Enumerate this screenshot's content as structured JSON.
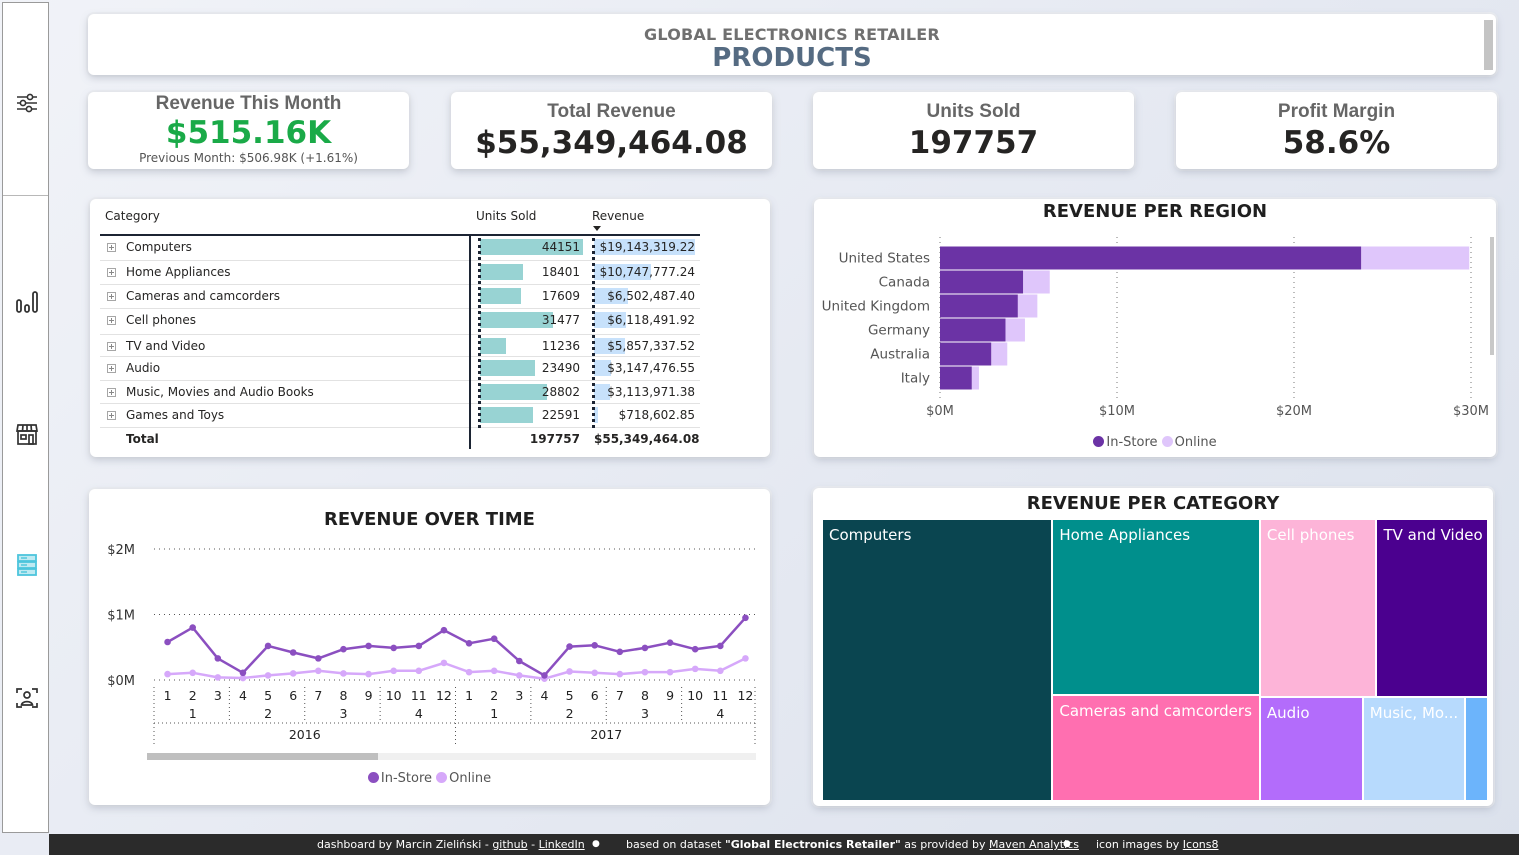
{
  "header": {
    "subtitle": "GLOBAL ELECTRONICS RETAILER",
    "title": "PRODUCTS"
  },
  "sidebar": {
    "items": [
      {
        "icon": "filter-sliders-icon",
        "active": false
      },
      {
        "icon": "bar-chart-icon",
        "active": false
      },
      {
        "icon": "store-icon",
        "active": false
      },
      {
        "icon": "products-database-icon",
        "active": true
      },
      {
        "icon": "customer-scan-icon",
        "active": false
      }
    ],
    "active_color": "#4dc5dc"
  },
  "kpis": {
    "revenue_this_month": {
      "label": "Revenue This Month",
      "value": "$515.16K",
      "previous": "Previous Month: $506.98K (+1.61%)",
      "color": "#1aaa48"
    },
    "total_revenue": {
      "label": "Total Revenue",
      "value": "$55,349,464.08"
    },
    "units_sold": {
      "label": "Units Sold",
      "value": "197757"
    },
    "profit_margin": {
      "label": "Profit Margin",
      "value": "58.6%"
    }
  },
  "matrix": {
    "headers": {
      "category": "Category",
      "units": "Units Sold",
      "revenue": "Revenue"
    },
    "rows": [
      {
        "category": "Computers",
        "units": "44151",
        "units_num": 44151,
        "revenue": "$19,143,319.22",
        "revenue_num": 19143319.22
      },
      {
        "category": "Home Appliances",
        "units": "18401",
        "units_num": 18401,
        "revenue": "$10,747,777.24",
        "revenue_num": 10747777.24
      },
      {
        "category": "Cameras and camcorders",
        "units": "17609",
        "units_num": 17609,
        "revenue": "$6,502,487.40",
        "revenue_num": 6502487.4
      },
      {
        "category": "Cell phones",
        "units": "31477",
        "units_num": 31477,
        "revenue": "$6,118,491.92",
        "revenue_num": 6118491.92
      },
      {
        "category": "TV and Video",
        "units": "11236",
        "units_num": 11236,
        "revenue": "$5,857,337.52",
        "revenue_num": 5857337.52
      },
      {
        "category": "Audio",
        "units": "23490",
        "units_num": 23490,
        "revenue": "$3,147,476.55",
        "revenue_num": 3147476.55
      },
      {
        "category": "Music, Movies and Audio Books",
        "units": "28802",
        "units_num": 28802,
        "revenue": "$3,113,971.38",
        "revenue_num": 3113971.38
      },
      {
        "category": "Games and Toys",
        "units": "22591",
        "units_num": 22591,
        "revenue": "$718,602.85",
        "revenue_num": 718602.85
      }
    ],
    "total": {
      "label": "Total",
      "units": "197757",
      "revenue": "$55,349,464.08"
    },
    "colors": {
      "units_bar": "#98d3d3",
      "revenue_bar": "#c7e1fb"
    }
  },
  "chart_data": [
    {
      "id": "region",
      "type": "bar",
      "orientation": "horizontal",
      "stacked": true,
      "title": "REVENUE PER REGION",
      "categories": [
        "United States",
        "Canada",
        "United Kingdom",
        "Germany",
        "Australia",
        "Italy"
      ],
      "series": [
        {
          "name": "In-Store",
          "color": "#6b33a5",
          "values": [
            23.8,
            4.7,
            4.4,
            3.7,
            2.9,
            1.8
          ]
        },
        {
          "name": "Online",
          "color": "#dfc6fb",
          "values": [
            6.1,
            1.5,
            1.1,
            1.1,
            0.9,
            0.4
          ]
        }
      ],
      "unit": "$M",
      "xlim": [
        0,
        30
      ],
      "x_ticks": [
        "$0M",
        "$10M",
        "$20M",
        "$30M"
      ],
      "x_tick_values": [
        0,
        10,
        20,
        30
      ],
      "grid": true,
      "legend": "bottom-center"
    },
    {
      "id": "time",
      "type": "line",
      "title": "REVENUE OVER TIME",
      "x_months": [
        "1",
        "2",
        "3",
        "4",
        "5",
        "6",
        "7",
        "8",
        "9",
        "10",
        "11",
        "12",
        "1",
        "2",
        "3",
        "4",
        "5",
        "6",
        "7",
        "8",
        "9",
        "10",
        "11",
        "12"
      ],
      "x_quarters": [
        "1",
        "2",
        "3",
        "4",
        "1",
        "2",
        "3",
        "4"
      ],
      "x_years": [
        "2016",
        "2017"
      ],
      "series": [
        {
          "name": "In-Store",
          "color": "#8b4fc0",
          "values": [
            0.58,
            0.8,
            0.33,
            0.11,
            0.52,
            0.42,
            0.33,
            0.47,
            0.52,
            0.49,
            0.52,
            0.76,
            0.56,
            0.63,
            0.29,
            0.07,
            0.51,
            0.53,
            0.43,
            0.49,
            0.57,
            0.47,
            0.52,
            0.95
          ]
        },
        {
          "name": "Online",
          "color": "#d6a8fa",
          "values": [
            0.09,
            0.11,
            0.04,
            0.03,
            0.07,
            0.1,
            0.14,
            0.1,
            0.09,
            0.14,
            0.14,
            0.26,
            0.12,
            0.14,
            0.07,
            0.02,
            0.13,
            0.11,
            0.09,
            0.12,
            0.12,
            0.17,
            0.14,
            0.33
          ]
        }
      ],
      "unit": "$M",
      "ylim": [
        0,
        2
      ],
      "y_ticks": [
        "$0M",
        "$1M",
        "$2M"
      ],
      "y_tick_values": [
        0,
        1,
        2
      ],
      "grid": true,
      "legend": "bottom-center",
      "scroll_fraction": 0.38
    },
    {
      "id": "category",
      "type": "treemap",
      "title": "REVENUE PER CATEGORY",
      "items": [
        {
          "label": "Computers",
          "display": "Computers",
          "value": 19143319.22,
          "color": "#0a4550"
        },
        {
          "label": "Home Appliances",
          "display": "Home Appliances",
          "value": 10747777.24,
          "color": "#008f8c"
        },
        {
          "label": "Cameras and camcorders",
          "display": "Cameras and camcorders",
          "value": 6502487.4,
          "color": "#ff6fb0"
        },
        {
          "label": "Cell phones",
          "display": "Cell phones",
          "value": 6118491.92,
          "color": "#fdb4d8"
        },
        {
          "label": "TV and Video",
          "display": "TV and Video",
          "value": 5857337.52,
          "color": "#4b008f"
        },
        {
          "label": "Audio",
          "display": "Audio",
          "value": 3147476.55,
          "color": "#b36cfb"
        },
        {
          "label": "Music, Movies and Audio Books",
          "display": "Music, Mo...",
          "value": 3113971.38,
          "color": "#b7dafd"
        },
        {
          "label": "Games and Toys",
          "display": "",
          "value": 718602.85,
          "color": "#6cb4fb"
        }
      ]
    }
  ],
  "footer": {
    "credit_prefix": "dashboard by Marcin Zieliński - ",
    "github": "github",
    "dash": " - ",
    "linkedin": "LinkedIn",
    "bullet": "●",
    "dataset_prefix": "based on dataset ",
    "dataset_name": "\"Global Electronics Retailer\"",
    "dataset_suffix": " as provided by ",
    "maven": "Maven Analytics",
    "icons_prefix": "icon images by ",
    "icons8": "Icons8"
  }
}
